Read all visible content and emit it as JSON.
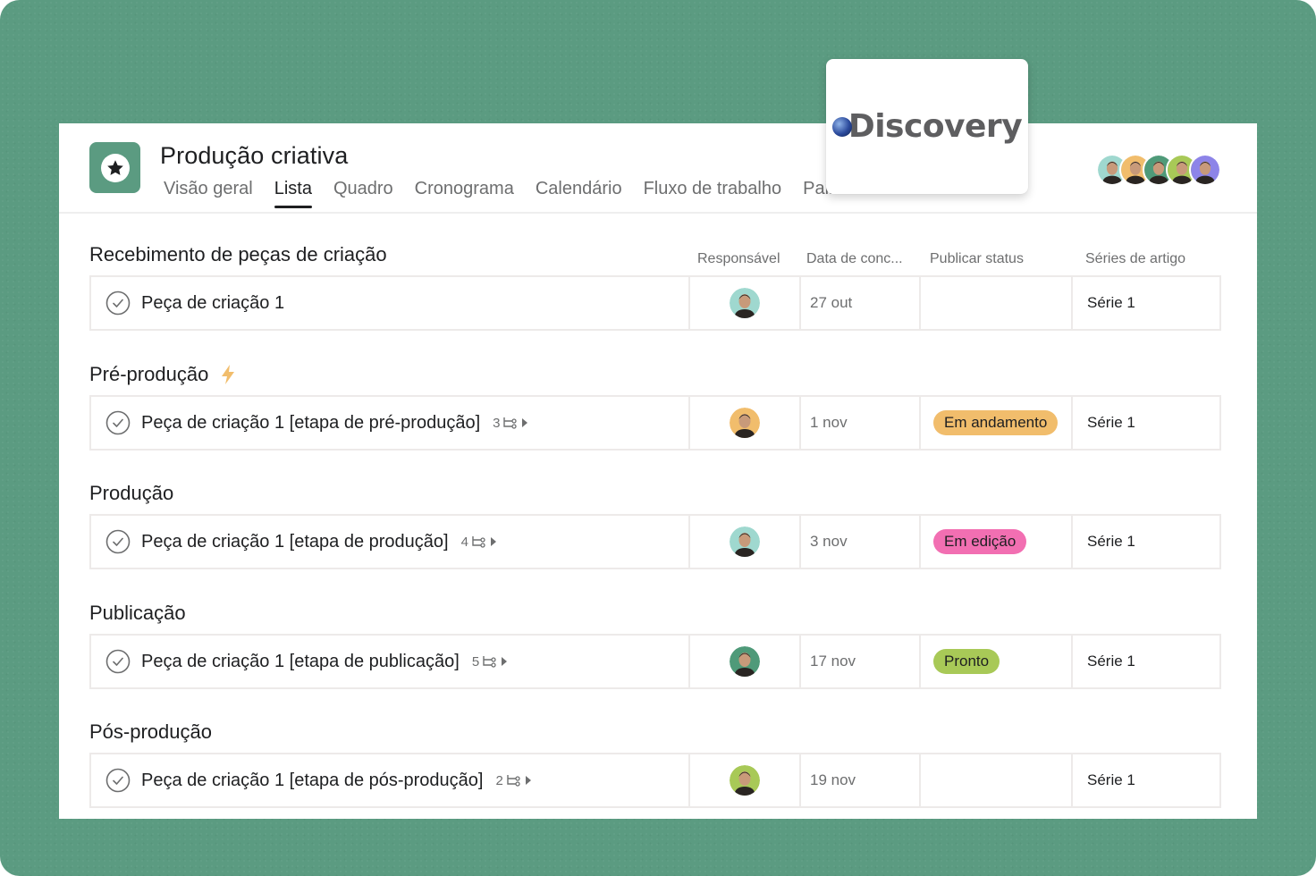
{
  "project": {
    "title": "Produção criativa",
    "icon": "star-icon",
    "accent_color": "#5b9b81"
  },
  "tabs": [
    {
      "label": "Visão geral",
      "active": false
    },
    {
      "label": "Lista",
      "active": true
    },
    {
      "label": "Quadro",
      "active": false
    },
    {
      "label": "Cronograma",
      "active": false
    },
    {
      "label": "Calendário",
      "active": false
    },
    {
      "label": "Fluxo de trabalho",
      "active": false
    },
    {
      "label": "Painel",
      "active": false
    }
  ],
  "members": [
    {
      "name": "member-1",
      "bg": "#9fd8cf"
    },
    {
      "name": "member-2",
      "bg": "#f1bd6c"
    },
    {
      "name": "member-3",
      "bg": "#4f9a79"
    },
    {
      "name": "member-4",
      "bg": "#a8c957"
    },
    {
      "name": "member-5",
      "bg": "#8d84e8"
    }
  ],
  "logo_card": {
    "text": "Discovery"
  },
  "columns": {
    "assignee": "Responsável",
    "due_date": "Data de conc...",
    "publish_status": "Publicar status",
    "series": "Séries de artigo"
  },
  "sections": [
    {
      "title": "Recebimento de peças de criação",
      "icon": null,
      "task": {
        "name": "Peça de criação 1",
        "subtask_count": null,
        "assignee_bg": "#9fd8cf",
        "due_date": "27 out",
        "status": null,
        "series": "Série 1"
      }
    },
    {
      "title": "Pré-produção",
      "icon": "lightning-icon",
      "task": {
        "name": "Peça de criação 1 [etapa de pré-produção]",
        "subtask_count": "3",
        "assignee_bg": "#f1bd6c",
        "due_date": "1 nov",
        "status": {
          "label": "Em andamento",
          "color": "#f1bd6c"
        },
        "series": "Série 1"
      }
    },
    {
      "title": "Produção",
      "icon": null,
      "task": {
        "name": "Peça de criação 1 [etapa de produção]",
        "subtask_count": "4",
        "assignee_bg": "#9fd8cf",
        "due_date": "3 nov",
        "status": {
          "label": "Em edição",
          "color": "#f26fb2"
        },
        "series": "Série 1"
      }
    },
    {
      "title": "Publicação",
      "icon": null,
      "task": {
        "name": "Peça de criação 1 [etapa de publicação]",
        "subtask_count": "5",
        "assignee_bg": "#4f9a79",
        "due_date": "17 nov",
        "status": {
          "label": "Pronto",
          "color": "#a8c957"
        },
        "series": "Série 1"
      }
    },
    {
      "title": "Pós-produção",
      "icon": null,
      "task": {
        "name": "Peça de criação 1 [etapa de pós-produção]",
        "subtask_count": "2",
        "assignee_bg": "#a8c957",
        "due_date": "19 nov",
        "status": null,
        "series": "Série 1"
      }
    }
  ]
}
